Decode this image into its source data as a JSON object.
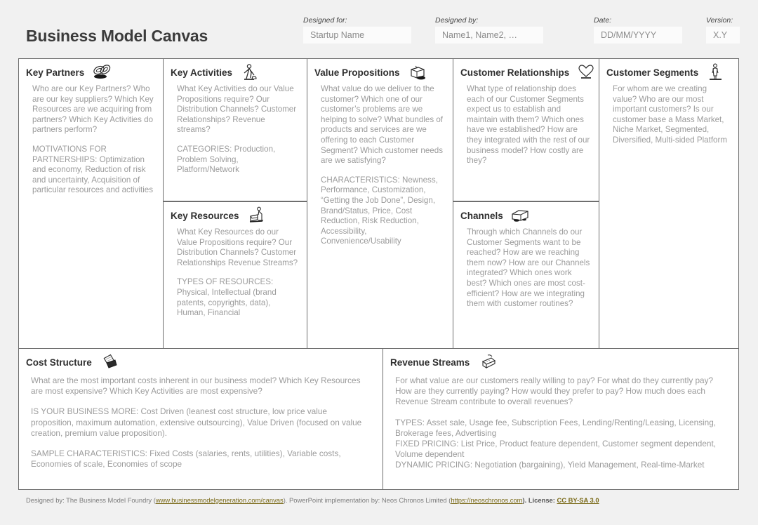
{
  "header": {
    "title": "Business Model Canvas",
    "fields": [
      {
        "label": "Designed for:",
        "placeholder": "Startup Name",
        "value": ""
      },
      {
        "label": "Designed by:",
        "placeholder": "Name1, Name2, …",
        "value": ""
      },
      {
        "label": "Date:",
        "placeholder": "DD/MM/YYYY",
        "value": ""
      },
      {
        "label": "Version:",
        "placeholder": "X.Y",
        "value": ""
      }
    ]
  },
  "blocks": {
    "key_partners": {
      "title": "Key Partners",
      "icon": "chain-links-icon",
      "paragraphs": [
        "Who are our Key Partners? Who are our key suppliers? Which Key Resources are we acquiring from partners? Which Key Activities do partners perform?",
        "MOTIVATIONS FOR PARTNERSHIPS: Optimization and economy, Reduction of risk and uncertainty, Acquisition of particular resources and activities"
      ]
    },
    "key_activities": {
      "title": "Key Activities",
      "icon": "worker-icon",
      "paragraphs": [
        "What Key Activities do our Value Propositions require? Our Distribution Channels? Customer Relationships? Revenue streams?",
        "CATEGORIES: Production, Problem Solving, Platform/Network"
      ]
    },
    "key_resources": {
      "title": "Key Resources",
      "icon": "forklift-icon",
      "paragraphs": [
        "What Key Resources do our Value Propositions require? Our Distribution Channels? Customer Relationships Revenue Streams?",
        "TYPES OF RESOURCES: Physical, Intellectual (brand patents, copyrights, data), Human, Financial"
      ]
    },
    "value_propositions": {
      "title": "Value Propositions",
      "icon": "gift-box-icon",
      "paragraphs": [
        "What value do we deliver to the customer? Which one of our customer’s problems are we helping to solve? What bundles of products and services are we offering to each Customer Segment? Which customer needs are we satisfying?",
        "CHARACTERISTICS: Newness, Performance, Customization, “Getting the Job Done”, Design, Brand/Status, Price, Cost Reduction, Risk Reduction, Accessibility, Convenience/Usability"
      ]
    },
    "customer_relationships": {
      "title": "Customer Relationships",
      "icon": "heart-icon",
      "paragraphs": [
        "What type of relationship does each of our Customer Segments expect us to establish and maintain with them? Which ones have we established? How are they integrated with the rest of our business model? How costly are they?"
      ]
    },
    "channels": {
      "title": "Channels",
      "icon": "truck-icon",
      "paragraphs": [
        "Through which Channels do our Customer Segments want to be reached? How are we reaching them now? How are our Channels integrated? Which ones work best? Which ones are most cost-efficient? How are we integrating them with customer routines?"
      ]
    },
    "customer_segments": {
      "title": "Customer Segments",
      "icon": "person-icon",
      "paragraphs": [
        "For whom are we creating value? Who are our most important customers? Is our customer base a Mass Market, Niche Market, Segmented, Diversified, Multi-sided Platform"
      ]
    },
    "cost_structure": {
      "title": "Cost Structure",
      "icon": "price-tags-icon",
      "paragraphs": [
        "What are the most important costs inherent in our business model? Which Key Resources are most expensive? Which Key Activities are most expensive?",
        "IS YOUR BUSINESS MORE: Cost Driven (leanest cost structure, low price value proposition, maximum automation, extensive outsourcing), Value Driven (focused on value creation, premium value proposition).",
        "SAMPLE CHARACTERISTICS: Fixed Costs (salaries, rents, utilities), Variable costs, Economies of scale, Economies of scope"
      ]
    },
    "revenue_streams": {
      "title": "Revenue Streams",
      "icon": "cash-register-icon",
      "paragraphs": [
        "For what value are our customers really willing to pay? For what do they currently pay? How are they currently paying? How would they prefer to pay? How much does each Revenue Stream contribute to overall revenues?",
        "TYPES: Asset sale, Usage fee, Subscription Fees, Lending/Renting/Leasing, Licensing, Brokerage fees, Advertising\nFIXED PRICING: List Price, Product feature dependent, Customer segment dependent, Volume dependent\nDYNAMIC PRICING: Negotiation (bargaining), Yield Management, Real-time-Market"
      ]
    }
  },
  "footer": {
    "designed_by_prefix": "Designed by: The Business Model Foundry (",
    "foundry_link": "www.businessmodelgeneration.com/canvas",
    "middle": "). PowerPoint implementation by: Neos Chronos Limited (",
    "neos_link": "https://neoschronos.com",
    "license_prefix": "). License: ",
    "license_link": "CC BY-SA 3.0"
  },
  "colors": {
    "background": "#f1f1f1",
    "border": "#6e6e6e",
    "title": "#3b3b3b",
    "body_text": "#9b9b9b",
    "link": "#7a6a18"
  }
}
